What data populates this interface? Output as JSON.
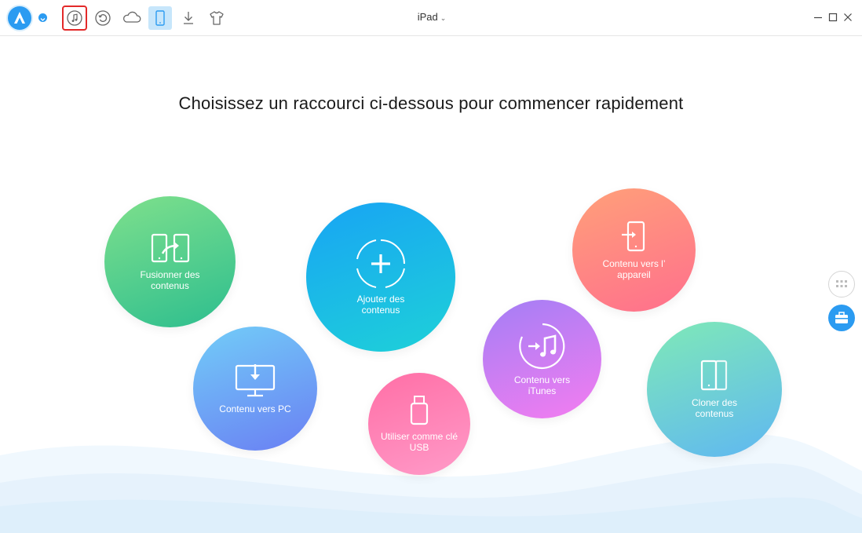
{
  "toolbar": {
    "icons": [
      "app-logo",
      "music-note-icon",
      "restore-icon",
      "cloud-icon",
      "phone-icon",
      "download-icon",
      "shirt-icon"
    ],
    "device_name": "iPad",
    "window_controls": [
      "minimize",
      "maximize",
      "close"
    ]
  },
  "main": {
    "heading": "Choisissez un raccourci ci-dessous pour commencer rapidement",
    "shortcuts": [
      {
        "id": "merge",
        "label": "Fusionner des contenus",
        "icon": "merge-icon"
      },
      {
        "id": "add",
        "label": "Ajouter des contenus",
        "icon": "plus-icon"
      },
      {
        "id": "to-device",
        "label": "Contenu vers l’ appareil",
        "icon": "to-device-icon"
      },
      {
        "id": "to-pc",
        "label": "Contenu vers PC",
        "icon": "monitor-icon"
      },
      {
        "id": "usb",
        "label": "Utiliser comme clé USB",
        "icon": "usb-icon"
      },
      {
        "id": "to-itunes",
        "label": "Contenu vers iTunes",
        "icon": "itunes-icon"
      },
      {
        "id": "clone",
        "label": "Cloner des contenus",
        "icon": "clone-icon"
      }
    ]
  },
  "colors": {
    "accent": "#2b9bf1",
    "highlight": "#e32929"
  }
}
